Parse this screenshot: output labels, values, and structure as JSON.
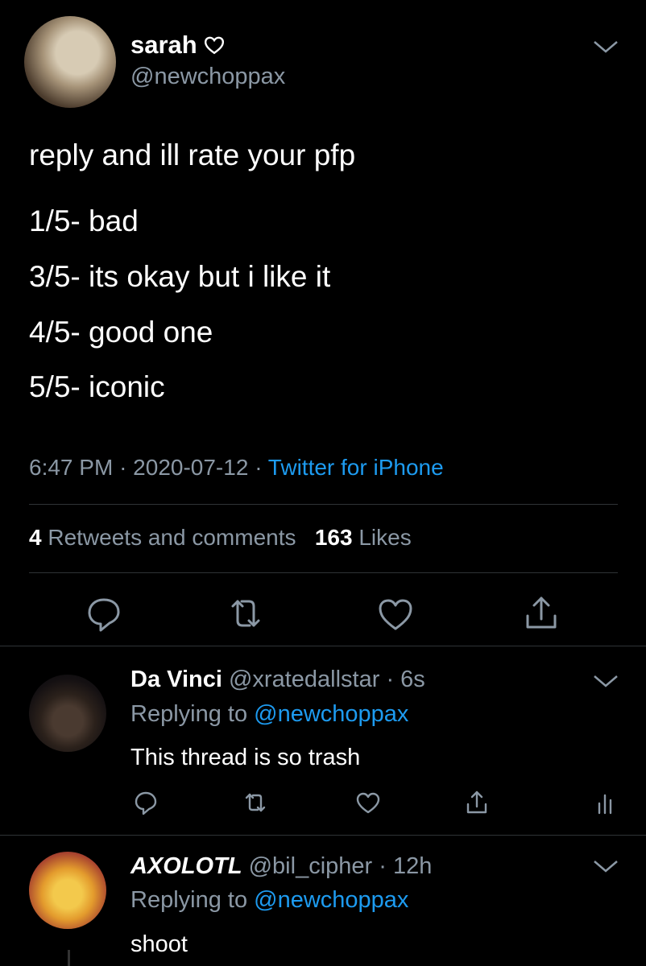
{
  "tweet": {
    "author_name": "sarah",
    "author_handle": "@newchoppax",
    "text": "reply and ill rate your pfp",
    "ratings": [
      "1/5- bad",
      "3/5- its okay but i like it",
      "4/5- good one",
      "5/5- iconic"
    ],
    "time": "6:47 PM",
    "separator": "·",
    "date": "2020-07-12",
    "source": "Twitter for iPhone",
    "retweets_count": "4",
    "retweets_label": "Retweets and comments",
    "likes_count": "163",
    "likes_label": "Likes"
  },
  "replies": [
    {
      "name": "Da Vinci",
      "handle": "@xratedallstar",
      "time": "· 6s",
      "replying_label": "Replying to",
      "replying_to": "@newchoppax",
      "text": "This thread is so trash"
    },
    {
      "name": "AXOLOTL",
      "handle": "@bil_cipher",
      "time": "· 12h",
      "replying_label": "Replying to",
      "replying_to": "@newchoppax",
      "text": "shoot"
    }
  ],
  "icons": [
    "heart-outline-icon",
    "chevron-down-icon",
    "reply-icon",
    "retweet-icon",
    "like-icon",
    "share-icon",
    "analytics-icon"
  ],
  "colors": {
    "background": "#000000",
    "text": "#ffffff",
    "muted": "#8b98a5",
    "link": "#1d9bf0",
    "divider": "#2f3336"
  }
}
